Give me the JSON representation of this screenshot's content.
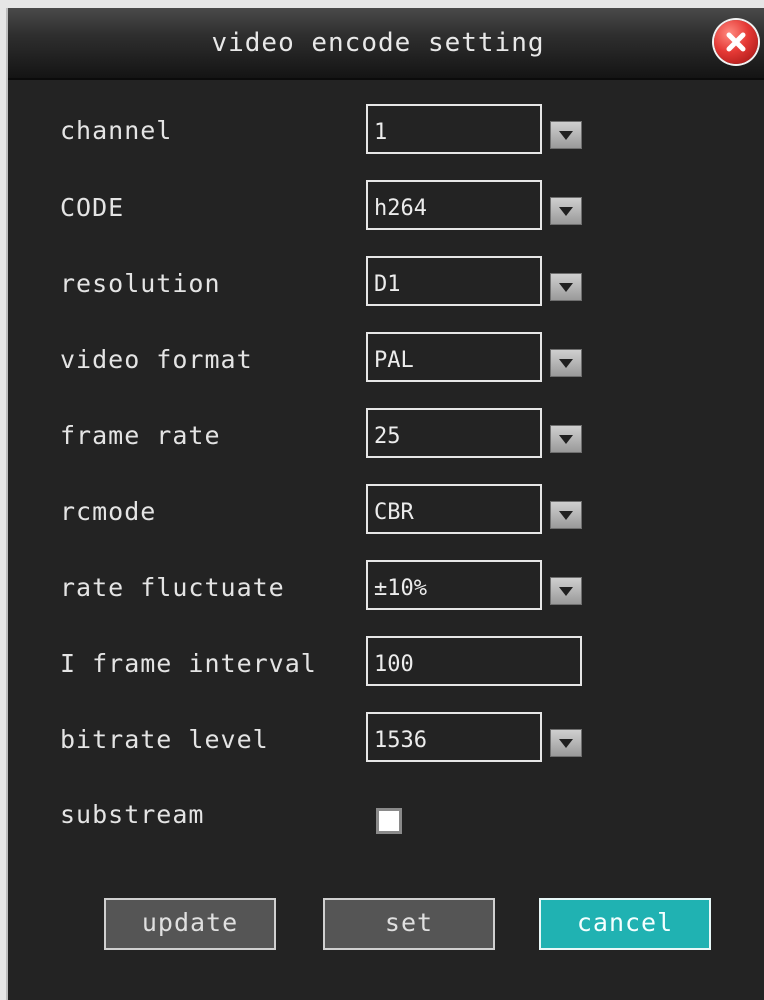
{
  "dialog": {
    "title": "video encode setting",
    "close_icon": "close-icon"
  },
  "fields": [
    {
      "label": "channel",
      "value": "1",
      "dropdown": true
    },
    {
      "label": "CODE",
      "value": "h264",
      "dropdown": true
    },
    {
      "label": "resolution",
      "value": "D1",
      "dropdown": true
    },
    {
      "label": "video format",
      "value": "PAL",
      "dropdown": true
    },
    {
      "label": "frame rate",
      "value": "25",
      "dropdown": true
    },
    {
      "label": "rcmode",
      "value": "CBR",
      "dropdown": true
    },
    {
      "label": "rate fluctuate",
      "value": "±10%",
      "dropdown": true
    },
    {
      "label": "I frame interval",
      "value": "100",
      "dropdown": false
    },
    {
      "label": "bitrate level",
      "value": "1536",
      "dropdown": true
    }
  ],
  "substream": {
    "label": "substream",
    "checked": false
  },
  "buttons": {
    "update": "update",
    "set": "set",
    "cancel": "cancel"
  },
  "colors": {
    "panel": "#232323",
    "accent_cancel": "#20b2b2",
    "close_red": "#e53935"
  }
}
